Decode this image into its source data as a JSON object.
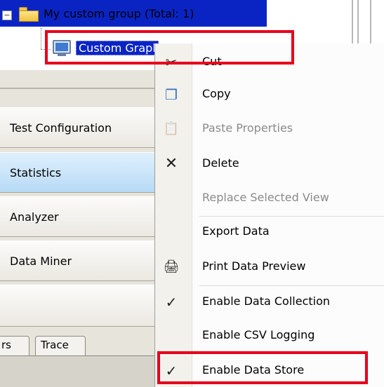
{
  "tree": {
    "group_label": "My custom group (Total: 1)",
    "graph_label": "Custom Graph",
    "expander_symbol": "−"
  },
  "nav": {
    "items": [
      {
        "label": "Test Configuration"
      },
      {
        "label": "Statistics",
        "active": true
      },
      {
        "label": "Analyzer"
      },
      {
        "label": "Data Miner"
      }
    ],
    "tabs": [
      {
        "label": "rs"
      },
      {
        "label": "Trace"
      }
    ]
  },
  "context_menu": {
    "items": [
      {
        "label": "Cut",
        "icon": "scissors-icon",
        "glyph": "✂",
        "enabled": true
      },
      {
        "label": "Copy",
        "icon": "copy-icon",
        "glyph": "❐",
        "enabled": true
      },
      {
        "label": "Paste Properties",
        "icon": "paste-icon",
        "glyph": "📋",
        "enabled": false
      },
      {
        "label": "Delete",
        "icon": "delete-icon",
        "glyph": "✕",
        "enabled": true
      },
      {
        "label": "Replace Selected View",
        "icon": "",
        "glyph": "",
        "enabled": false
      },
      {
        "label": "Export Data",
        "icon": "",
        "glyph": "",
        "enabled": true
      },
      {
        "label": "Print Data Preview",
        "icon": "printer-icon",
        "glyph": "🖨",
        "enabled": true
      },
      {
        "label": "Enable Data Collection",
        "icon": "checkmark-icon",
        "glyph": "✓",
        "enabled": true,
        "checked": true
      },
      {
        "label": "Enable CSV Logging",
        "icon": "",
        "glyph": "",
        "enabled": true,
        "checked": false
      },
      {
        "label": "Enable Data Store",
        "icon": "checkmark-icon",
        "glyph": "✓",
        "enabled": true,
        "checked": true
      }
    ]
  },
  "colors": {
    "selection": "#0a24c4",
    "highlight_box": "#e6001c",
    "nav_active": "#b7daf6"
  }
}
